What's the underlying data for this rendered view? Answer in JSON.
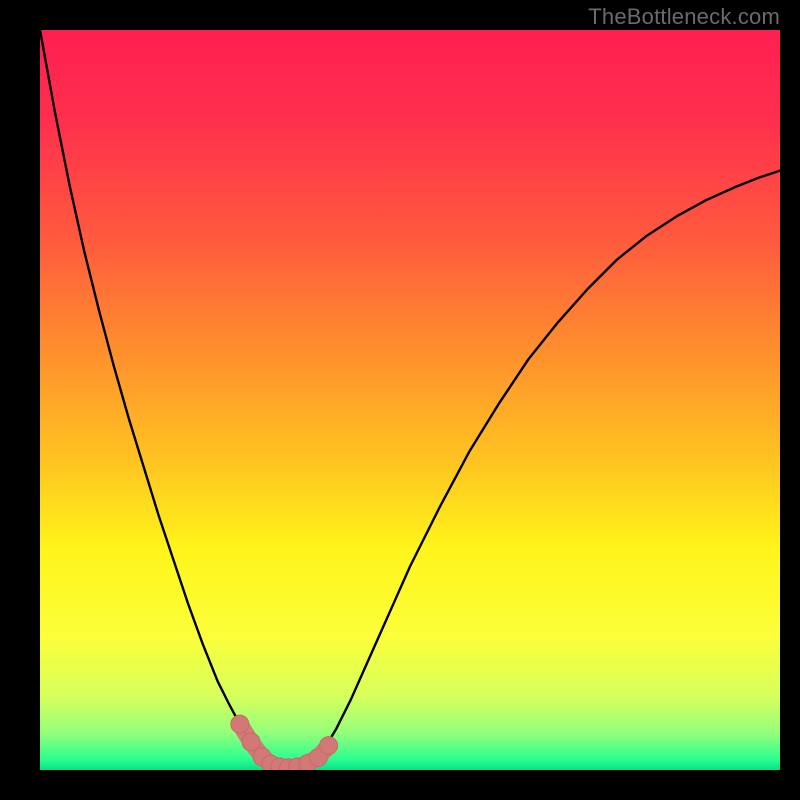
{
  "watermark": "TheBottleneck.com",
  "colors": {
    "frame": "#000000",
    "curve": "#000000",
    "marker_fill": "#d27877",
    "marker_stroke": "#c86a69",
    "gradient_stops": [
      {
        "offset": 0.0,
        "color": "#ff1f52"
      },
      {
        "offset": 0.12,
        "color": "#ff2f4d"
      },
      {
        "offset": 0.28,
        "color": "#ff593e"
      },
      {
        "offset": 0.42,
        "color": "#ff8a2f"
      },
      {
        "offset": 0.58,
        "color": "#ffc321"
      },
      {
        "offset": 0.7,
        "color": "#fff41a"
      },
      {
        "offset": 0.82,
        "color": "#fbff3a"
      },
      {
        "offset": 0.9,
        "color": "#d7ff5c"
      },
      {
        "offset": 0.95,
        "color": "#94ff7a"
      },
      {
        "offset": 0.985,
        "color": "#2dff8f"
      },
      {
        "offset": 1.0,
        "color": "#06e08b"
      }
    ]
  },
  "chart_data": {
    "type": "line",
    "title": "",
    "xlabel": "",
    "ylabel": "",
    "x": [
      0.0,
      0.02,
      0.04,
      0.06,
      0.08,
      0.1,
      0.12,
      0.14,
      0.16,
      0.18,
      0.2,
      0.22,
      0.24,
      0.255,
      0.27,
      0.28,
      0.29,
      0.3,
      0.31,
      0.32,
      0.33,
      0.34,
      0.35,
      0.36,
      0.37,
      0.38,
      0.4,
      0.42,
      0.44,
      0.46,
      0.48,
      0.5,
      0.54,
      0.58,
      0.62,
      0.66,
      0.7,
      0.74,
      0.78,
      0.82,
      0.86,
      0.9,
      0.94,
      0.97,
      1.0
    ],
    "y": [
      1.0,
      0.89,
      0.79,
      0.7,
      0.62,
      0.545,
      0.475,
      0.41,
      0.345,
      0.285,
      0.225,
      0.17,
      0.12,
      0.09,
      0.062,
      0.045,
      0.03,
      0.018,
      0.01,
      0.005,
      0.003,
      0.002,
      0.003,
      0.006,
      0.012,
      0.022,
      0.055,
      0.095,
      0.14,
      0.185,
      0.23,
      0.275,
      0.355,
      0.43,
      0.495,
      0.555,
      0.605,
      0.65,
      0.69,
      0.722,
      0.748,
      0.77,
      0.788,
      0.8,
      0.81
    ],
    "xlim": [
      0,
      1
    ],
    "ylim": [
      0,
      1
    ],
    "markers": {
      "x": [
        0.27,
        0.285,
        0.3,
        0.312,
        0.324,
        0.336,
        0.348,
        0.362,
        0.376,
        0.39
      ],
      "y": [
        0.062,
        0.038,
        0.018,
        0.008,
        0.004,
        0.003,
        0.004,
        0.009,
        0.017,
        0.033
      ]
    }
  }
}
